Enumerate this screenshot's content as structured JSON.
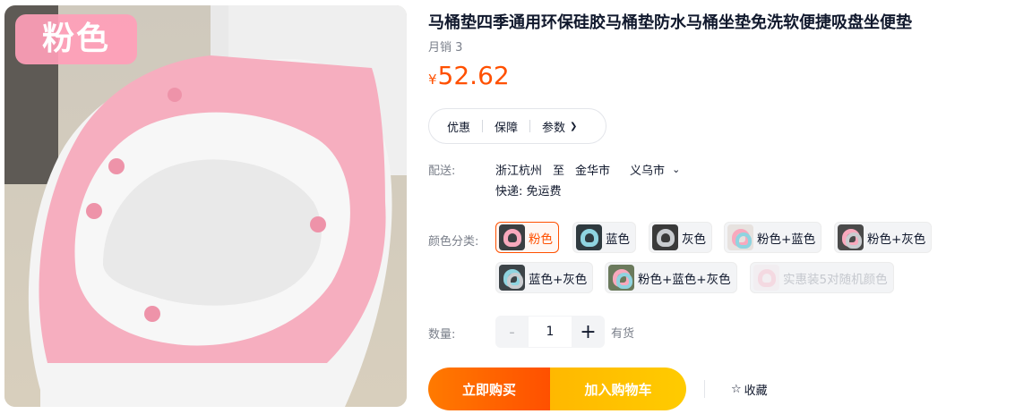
{
  "image": {
    "tag": "粉色"
  },
  "product": {
    "title": "马桶垫四季通用环保硅胶马桶垫防水马桶坐垫免洗软便捷吸盘坐便垫",
    "monthly_sales": "月销 3",
    "currency": "¥",
    "price": "52.62"
  },
  "tabs": [
    {
      "label": "优惠"
    },
    {
      "label": "保障"
    },
    {
      "label": "参数"
    }
  ],
  "shipping": {
    "label": "配送:",
    "from": "浙江杭州",
    "to_word": "至",
    "city": "金华市",
    "district": "义乌市",
    "express": "快递: 免运费"
  },
  "color": {
    "label": "颜色分类:",
    "options": [
      {
        "label": "粉色",
        "state": "selected"
      },
      {
        "label": "蓝色",
        "state": "normal"
      },
      {
        "label": "灰色",
        "state": "normal"
      },
      {
        "label": "粉色+蓝色",
        "state": "normal"
      },
      {
        "label": "粉色+灰色",
        "state": "normal"
      },
      {
        "label": "蓝色+灰色",
        "state": "normal"
      },
      {
        "label": "粉色+蓝色+灰色",
        "state": "normal"
      },
      {
        "label": "实惠装5对随机颜色",
        "state": "disabled"
      }
    ]
  },
  "quantity": {
    "label": "数量:",
    "minus": "-",
    "value": "1",
    "plus": "+",
    "stock": "有货"
  },
  "actions": {
    "buy_now": "立即购买",
    "add_cart": "加入购物车",
    "favorite": "收藏"
  },
  "colors": {
    "accent": "#ff5000",
    "cart": "#ffc200",
    "pink": "#f8a9bd"
  }
}
